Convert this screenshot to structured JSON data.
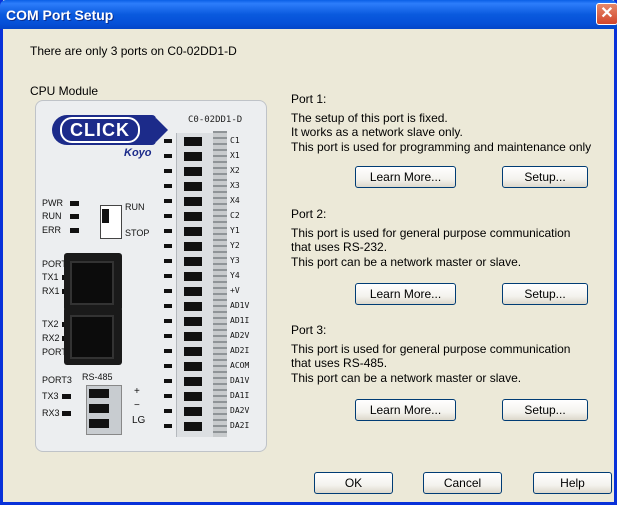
{
  "window": {
    "title": "COM Port Setup"
  },
  "info": {
    "text": "There are only  3   ports on  C0-02DD1-D"
  },
  "cpu": {
    "label": "CPU Module",
    "brand": "CLICK",
    "maker": "Koyo",
    "model": "C0-02DD1-D",
    "leds": [
      "PWR",
      "RUN",
      "ERR"
    ],
    "switch": {
      "run": "RUN",
      "stop": "STOP"
    },
    "port1": {
      "name": "PORT1",
      "tx": "TX1",
      "rx": "RX1"
    },
    "port2": {
      "name": "PORT2",
      "tx": "TX2",
      "rx": "RX2"
    },
    "port3": {
      "name": "PORT3",
      "type": "RS-485",
      "tx": "TX3",
      "rx": "RX3",
      "plus": "+",
      "minus": "−",
      "lg": "LG"
    },
    "terminals": [
      "C1",
      "X1",
      "X2",
      "X3",
      "X4",
      "C2",
      "Y1",
      "Y2",
      "Y3",
      "Y4",
      "+V",
      "AD1V",
      "AD1I",
      "AD2V",
      "AD2I",
      "ACOM",
      "DA1V",
      "DA1I",
      "DA2V",
      "DA2I"
    ]
  },
  "ports": [
    {
      "title": "Port 1:",
      "lines": [
        "The setup of this port is fixed.",
        "It works as a network slave only.",
        "This port is used for programming and maintenance only"
      ],
      "learn_more": "Learn More...",
      "setup": "Setup..."
    },
    {
      "title": "Port 2:",
      "lines": [
        "This port is used for general purpose communication",
        "that uses RS-232.",
        "This port can be a network master or slave."
      ],
      "learn_more": "Learn More...",
      "setup": "Setup..."
    },
    {
      "title": "Port 3:",
      "lines": [
        "This port is used for general purpose communication",
        "that uses RS-485.",
        "This port can be a network master or slave."
      ],
      "learn_more": "Learn More...",
      "setup": "Setup..."
    }
  ],
  "footer": {
    "ok": "OK",
    "cancel": "Cancel",
    "help": "Help"
  }
}
